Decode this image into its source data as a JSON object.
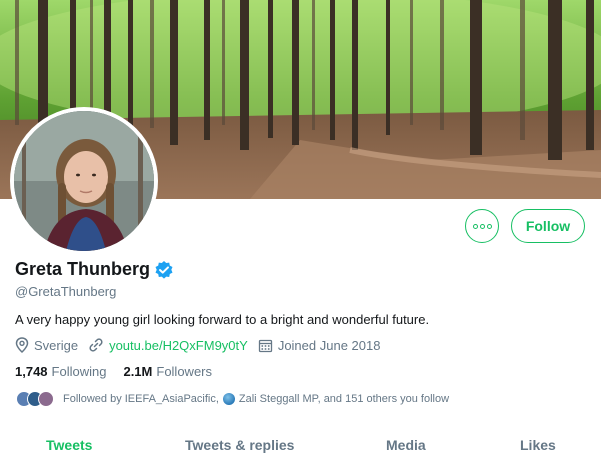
{
  "profile": {
    "display_name": "Greta Thunberg",
    "handle": "@GretaThunberg",
    "bio": "A very happy young girl looking forward to a bright and wonderful future.",
    "location": "Sverige",
    "website": "youtu.be/H2QxFM9y0tY",
    "joined": "Joined June 2018",
    "verified": true
  },
  "actions": {
    "more_label": "...",
    "follow_label": "Follow"
  },
  "stats": {
    "following_value": "1,748",
    "following_label": "Following",
    "followers_value": "2.1M",
    "followers_label": "Followers"
  },
  "followed_by": {
    "prefix": "Followed by IEEFA_AsiaPacific,",
    "rest": "Zali Steggall MP, and 151 others you follow"
  },
  "tabs": [
    {
      "label": "Tweets",
      "active": true
    },
    {
      "label": "Tweets & replies",
      "active": false
    },
    {
      "label": "Media",
      "active": false
    },
    {
      "label": "Likes",
      "active": false
    }
  ],
  "icons": {
    "verified": "verified-badge-icon",
    "location": "location-pin-icon",
    "link": "link-icon",
    "calendar": "calendar-icon",
    "more": "more-icon"
  },
  "colors": {
    "accent": "#17bf63",
    "verified": "#1da1f2",
    "muted_text": "#657786",
    "primary_text": "#14171a"
  }
}
